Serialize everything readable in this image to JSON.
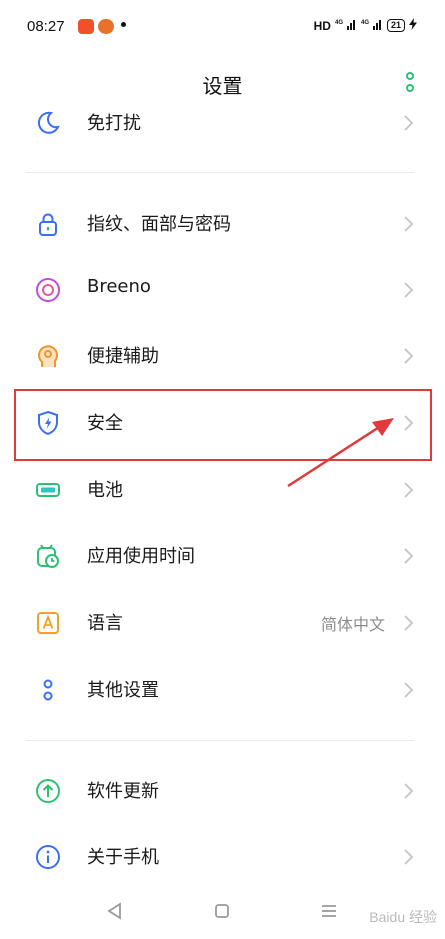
{
  "status_bar": {
    "time": "08:27",
    "network": "HD",
    "signal1": "4G",
    "signal2": "4G",
    "battery": "21"
  },
  "header": {
    "title": "设置"
  },
  "items": [
    {
      "label": "免打扰",
      "icon": "moon-icon"
    },
    {
      "label": "指纹、面部与密码",
      "icon": "lock-icon"
    },
    {
      "label": "Breeno",
      "icon": "breeno-icon"
    },
    {
      "label": "便捷辅助",
      "icon": "accessibility-head-icon"
    },
    {
      "label": "安全",
      "icon": "shield-icon"
    },
    {
      "label": "电池",
      "icon": "battery-icon"
    },
    {
      "label": "应用使用时间",
      "icon": "app-timer-icon"
    },
    {
      "label": "语言",
      "value": "简体中文",
      "icon": "language-a-icon"
    },
    {
      "label": "其他设置",
      "icon": "other-settings-icon"
    },
    {
      "label": "软件更新",
      "icon": "update-arrow-icon"
    },
    {
      "label": "关于手机",
      "icon": "info-icon"
    }
  ],
  "watermark": "Baidu 经验",
  "colors": {
    "accent_green": "#2fbf71",
    "icon_blue": "#3a6ff0",
    "highlight_red": "#e03a3a"
  }
}
